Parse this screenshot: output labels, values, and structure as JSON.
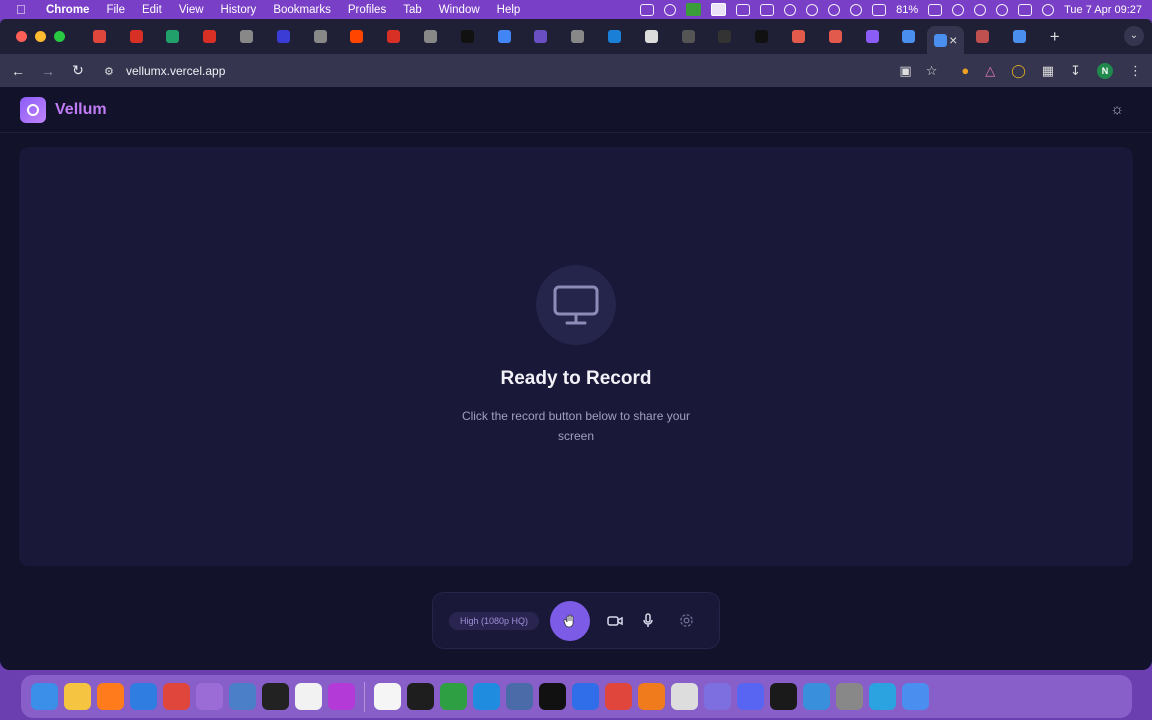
{
  "menubar": {
    "app_name": "Chrome",
    "menus": [
      "File",
      "Edit",
      "View",
      "History",
      "Bookmarks",
      "Profiles",
      "Tab",
      "Window",
      "Help"
    ],
    "battery": "81%",
    "datetime": "Tue 7 Apr  09:27"
  },
  "browser": {
    "url": "vellumx.vercel.app",
    "profile_initial": "N",
    "tab_colors": [
      "#e0463c",
      "#d93025",
      "#22a06b",
      "#d93025",
      "#888888",
      "#3b3bd6",
      "#888888",
      "#ff4500",
      "#d93025",
      "#888888",
      "#111111",
      "#4285f4",
      "#6a4fc2",
      "#888888",
      "#1a7fd6",
      "#dddddd",
      "#555555",
      "#333333",
      "#111111",
      "#e25a4c",
      "#e25a4c",
      "#8b5cf6",
      "#4a8ff0",
      "#4a8ff0",
      "#c04f4f",
      "#4a8ff0"
    ]
  },
  "app": {
    "brand": "Vellum",
    "ready_title": "Ready to Record",
    "ready_subtitle": "Click the record button below to share your screen",
    "quality": "High (1080p HQ)"
  },
  "dock": {
    "apps": [
      "#3b8fe8",
      "#f5c542",
      "#ff7b1c",
      "#2f7de1",
      "#e0463c",
      "#9b6bd6",
      "#4b7fc8",
      "#222222",
      "#f2f2f2",
      "#b33ad6",
      "#f5f5f5",
      "#1e1e1e",
      "#2ea043",
      "#1f8ce0",
      "#4a6aa8",
      "#111111",
      "#2f6ee8",
      "#e0463c",
      "#f07b1c",
      "#dddddd",
      "#7d6fe0",
      "#5865f2",
      "#1a1a1a",
      "#3a8fdc",
      "#888888",
      "#2aa3e0",
      "#4a8ff0"
    ]
  },
  "colors": {
    "accent": "#7c5ce6",
    "brand_text": "#c07cf4",
    "background": "#12122b"
  }
}
